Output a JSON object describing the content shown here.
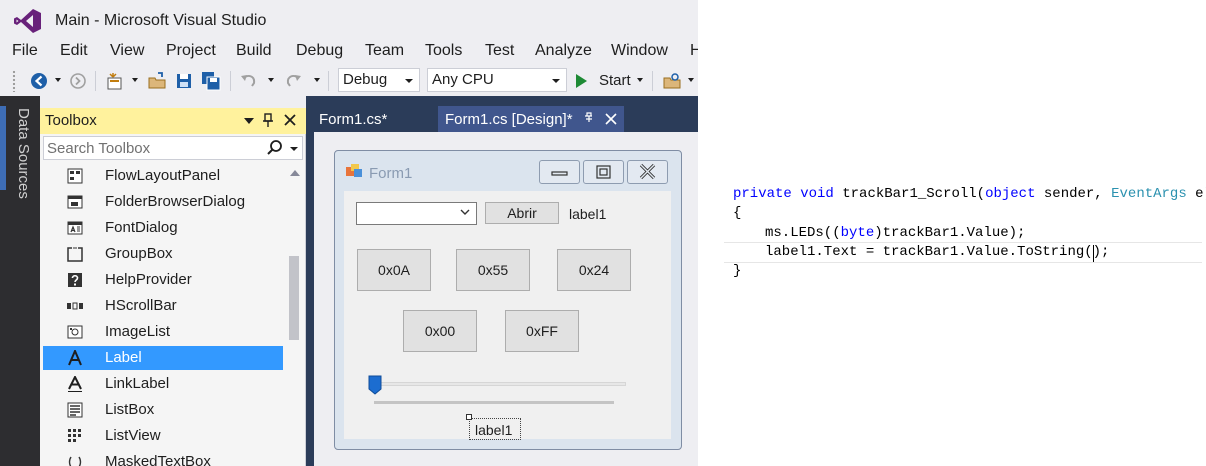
{
  "window": {
    "title": "Main - Microsoft Visual Studio"
  },
  "menu": [
    "File",
    "Edit",
    "View",
    "Project",
    "Build",
    "Debug",
    "Team",
    "Tools",
    "Test",
    "Analyze",
    "Window",
    "H"
  ],
  "toolbar": {
    "config": "Debug",
    "platform": "Any CPU",
    "start": "Start"
  },
  "side_panel": {
    "label": "Data Sources"
  },
  "toolbox": {
    "title": "Toolbox",
    "search_placeholder": "Search Toolbox",
    "items": [
      {
        "label": "FlowLayoutPanel",
        "icon": "flow-layout-panel-icon"
      },
      {
        "label": "FolderBrowserDialog",
        "icon": "folder-browser-dialog-icon"
      },
      {
        "label": "FontDialog",
        "icon": "font-dialog-icon"
      },
      {
        "label": "GroupBox",
        "icon": "group-box-icon"
      },
      {
        "label": "HelpProvider",
        "icon": "help-provider-icon"
      },
      {
        "label": "HScrollBar",
        "icon": "hscrollbar-icon"
      },
      {
        "label": "ImageList",
        "icon": "image-list-icon"
      },
      {
        "label": "Label",
        "icon": "label-icon",
        "selected": true
      },
      {
        "label": "LinkLabel",
        "icon": "link-label-icon"
      },
      {
        "label": "ListBox",
        "icon": "list-box-icon"
      },
      {
        "label": "ListView",
        "icon": "list-view-icon"
      },
      {
        "label": "MaskedTextBox",
        "icon": "masked-text-box-icon"
      }
    ]
  },
  "tabs": [
    {
      "label": "Form1.cs*",
      "active": false
    },
    {
      "label": "Form1.cs [Design]*",
      "active": true
    }
  ],
  "form": {
    "title": "Form1",
    "open_button": "Abrir",
    "top_label": "label1",
    "buttons_row1": [
      "0x0A",
      "0x55",
      "0x24"
    ],
    "buttons_row2": [
      "0x00",
      "0xFF"
    ],
    "bottom_label": "label1",
    "trackbar_value": 0
  },
  "code": {
    "line1_kw1": "private",
    "line1_kw2": "void",
    "line1_name": "trackBar1_Scroll(",
    "line1_kw3": "object",
    "line1_mid": "sender,",
    "line1_type": "EventArgs",
    "line1_end": "e)",
    "line2": "{",
    "line3_a": "ms.LEDs((",
    "line3_kw": "byte",
    "line3_b": ")trackBar1.Value);",
    "line4": "label1.Text = trackBar1.Value.ToString();",
    "line5": "}"
  },
  "colors": {
    "toolbox_header": "#fff29d",
    "selection": "#3399ff",
    "doc_background": "#2b3c59",
    "active_tab": "#40568d",
    "keyword": "#0000ff",
    "type": "#2b91af"
  }
}
